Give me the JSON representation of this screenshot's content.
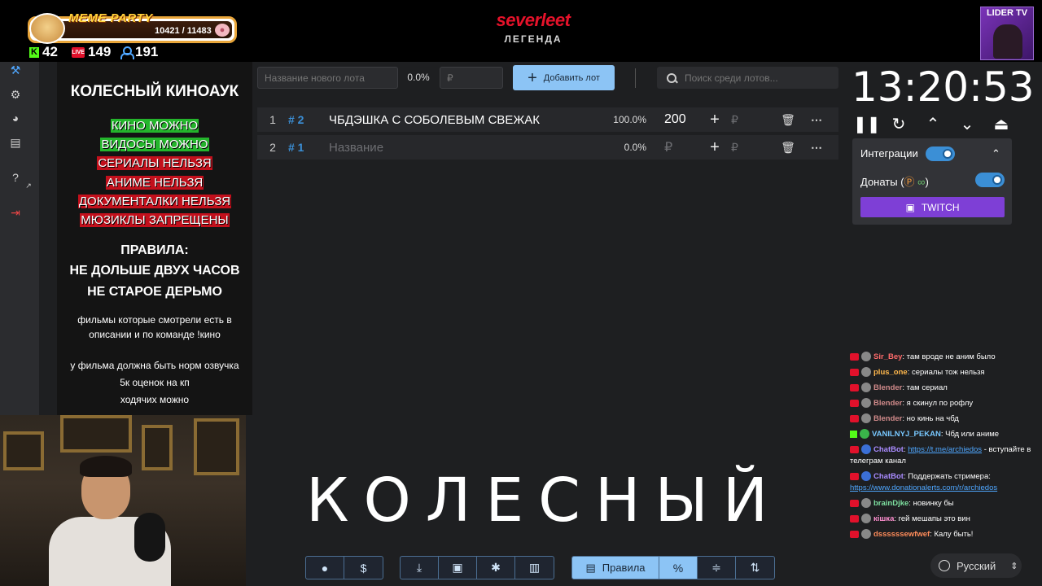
{
  "overlay": {
    "meme_party": {
      "title": "MEME PARTY",
      "progress": "10421 / 11483"
    },
    "stats": {
      "kick": "42",
      "live": "149",
      "viewers": "191"
    },
    "brand": {
      "logo": "severleet",
      "subtitle": "ЛЕГЕНДА"
    },
    "channel_badge": "LIDER TV"
  },
  "rules": {
    "title": "КОЛЕСНЫЙ КИНОАУК",
    "allowed_denied": [
      {
        "text": "КИНО МОЖНО",
        "status": "ok"
      },
      {
        "text": "ВИДОСЫ МОЖНО",
        "status": "ok"
      },
      {
        "text": "СЕРИАЛЫ НЕЛЬЗЯ",
        "status": "no"
      },
      {
        "text": "АНИМЕ НЕЛЬЗЯ",
        "status": "no"
      },
      {
        "text": "ДОКУМЕНТАЛКИ НЕЛЬЗЯ",
        "status": "no"
      },
      {
        "text": "МЮЗИКЛЫ ЗАПРЕЩЕНЫ",
        "status": "no"
      }
    ],
    "heading": "ПРАВИЛА:",
    "line1": "НЕ ДОЛЬШЕ ДВУХ ЧАСОВ",
    "line2": "НЕ СТАРОЕ ДЕРЬМО",
    "note1a": "фильмы которые смотрели есть в",
    "note1b": "описании и по команде !кино",
    "note2a": "у фильма должна быть норм озвучка",
    "note2b": "5к оценок на кп",
    "note2c": "ходячих можно"
  },
  "toolbar": {
    "new_lot_placeholder": "Название нового лота",
    "percent": "0.0%",
    "amount_placeholder": "₽",
    "add_lot_label": "Добавить лот",
    "search_placeholder": "Поиск среди лотов..."
  },
  "lots": [
    {
      "index": "1",
      "hash": "# 2",
      "name": "ЧБДЭШКА С СОБОЛЕВЫМ СВЕЖАК",
      "percent": "100.0%",
      "amount": "200",
      "currency": "₽"
    },
    {
      "index": "2",
      "hash": "# 1",
      "name": "Название",
      "percent": "0.0%",
      "amount": "₽",
      "currency": "₽"
    }
  ],
  "big_text": "КОЛЕСНЫЙ",
  "bottom_toolbar": {
    "rules_label": "Правила",
    "percent_symbol": "%",
    "dollar_symbol": "$"
  },
  "timer": {
    "time": "13:20:53"
  },
  "integrations": {
    "label": "Интеграции",
    "donations_label": "Донаты (",
    "donations_suffix": ")",
    "twitch_label": "TWITCH"
  },
  "chat": [
    {
      "platform": "live",
      "user": "Sir_Bey",
      "color": "#ff6b6b",
      "text": "там вроде не аним было"
    },
    {
      "platform": "live",
      "user": "plus_one",
      "color": "#ffb84d",
      "text": "сериалы тож нельзя"
    },
    {
      "platform": "live",
      "user": "Blender",
      "color": "#d08a8a",
      "text": "там сериал"
    },
    {
      "platform": "live",
      "user": "Blender",
      "color": "#d08a8a",
      "text": "я скинул по рофлу"
    },
    {
      "platform": "live",
      "user": "Blender",
      "color": "#d08a8a",
      "text": "но кинь на чбд"
    },
    {
      "platform": "kick",
      "user": "VANILNYJ_PEKAN",
      "color": "#78c8ff",
      "text": "Чбд или аниме"
    },
    {
      "platform": "live",
      "user": "ChatBot",
      "color": "#a98bff",
      "text": "- вступайте в телеграм канал",
      "link": "https://t.me/archiedos"
    },
    {
      "platform": "live",
      "user": "ChatBot",
      "color": "#a98bff",
      "text": "Поддержать стримера:",
      "link": "https://www.donationalerts.com/r/archiedos"
    },
    {
      "platform": "live",
      "user": "brainDjke",
      "color": "#7ee0a0",
      "text": "новинку бы"
    },
    {
      "platform": "live",
      "user": "кішка",
      "color": "#ff8fd0",
      "text": "гей мешапы это вин"
    },
    {
      "platform": "live",
      "user": "dssssssewfwef",
      "color": "#ff8c5a",
      "text": "Калу быть!"
    }
  ],
  "language": {
    "selected": "Русский"
  },
  "colors": {
    "accent": "#8cc4f5",
    "allowed": "#24b52c",
    "denied": "#c2101c",
    "twitch": "#7e3fd6",
    "background": "#1e1f21"
  }
}
